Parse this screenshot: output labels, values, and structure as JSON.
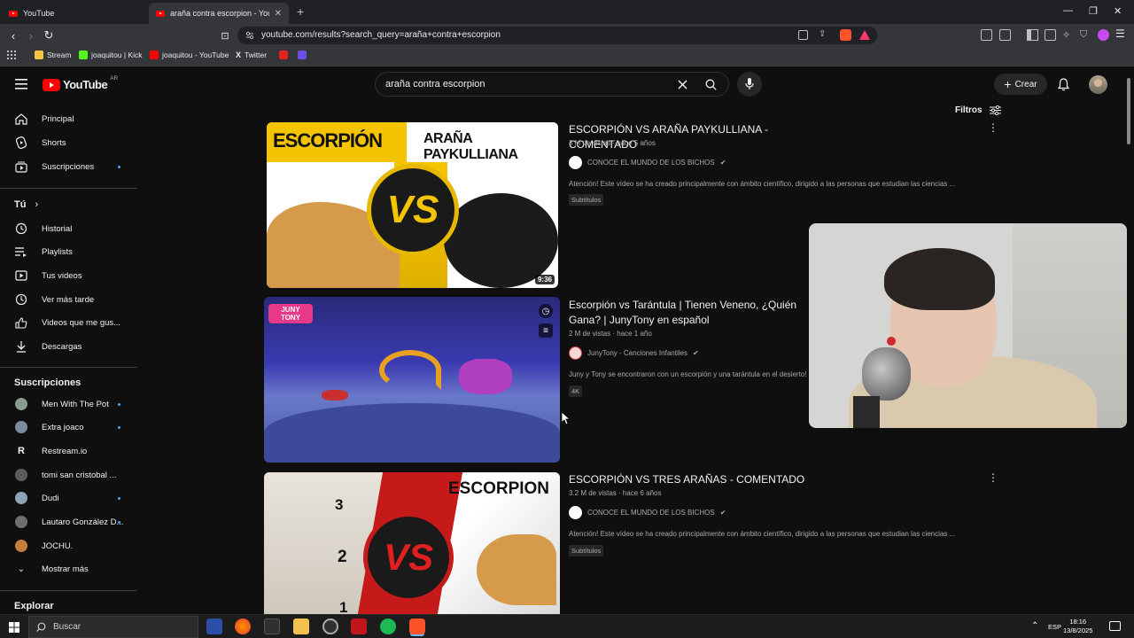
{
  "browser": {
    "tabs": [
      {
        "title": "YouTube",
        "active": false
      },
      {
        "title": "araña contra escorpion - YouTube",
        "active": true
      }
    ],
    "url": "youtube.com/results?search_query=araña+contra+escorpion",
    "bookmarks": [
      {
        "label": "Stream",
        "icon": "folder-icon",
        "color": "#f6c445"
      },
      {
        "label": "joaquitou | Kick",
        "icon": "kick-icon",
        "color": "#53fc18"
      },
      {
        "label": "joaquitou - YouTube",
        "icon": "youtube-icon",
        "color": "#ff0000"
      },
      {
        "label": "Twitter",
        "icon": "x-icon",
        "color": "#000000"
      },
      {
        "label": "",
        "icon": "red-bookmark-icon",
        "color": "#e02424"
      },
      {
        "label": "",
        "icon": "purple-bookmark-icon",
        "color": "#6c4ee4"
      }
    ]
  },
  "header": {
    "logo_text": "YouTube",
    "region": "AR",
    "search_value": "araña contra escorpion",
    "create_label": "Crear",
    "filters_label": "Filtros"
  },
  "sidebar": {
    "main": [
      {
        "label": "Principal",
        "icon": "home-icon",
        "dot": false
      },
      {
        "label": "Shorts",
        "icon": "shorts-icon",
        "dot": false
      },
      {
        "label": "Suscripciones",
        "icon": "subscriptions-icon",
        "dot": true
      }
    ],
    "you_label": "Tú",
    "you": [
      {
        "label": "Historial",
        "icon": "history-icon"
      },
      {
        "label": "Playlists",
        "icon": "playlists-icon"
      },
      {
        "label": "Tus videos",
        "icon": "your-videos-icon"
      },
      {
        "label": "Ver más tarde",
        "icon": "watch-later-icon"
      },
      {
        "label": "Videos que me gus...",
        "icon": "liked-icon"
      },
      {
        "label": "Descargas",
        "icon": "download-icon"
      }
    ],
    "subs_label": "Suscripciones",
    "subs": [
      {
        "label": "Men With The Pot",
        "color": "#8a9a8c",
        "dot": true
      },
      {
        "label": "Extra joaco",
        "color": "#7b8a9a",
        "dot": true
      },
      {
        "label": "Restream.io",
        "color": "#0f0f0f",
        "dot": false
      },
      {
        "label": "tomi san cristobal ...",
        "color": "#5c5c5c",
        "dot": false
      },
      {
        "label": "Dudi",
        "color": "#8fa3b8",
        "dot": true
      },
      {
        "label": "Lautaro González D...",
        "color": "#6d6d6d",
        "dot": true
      },
      {
        "label": "JOCHU.",
        "color": "#c87d3a",
        "dot": false
      }
    ],
    "more_label": "Mostrar más",
    "explore_label": "Explorar"
  },
  "results": [
    {
      "title": "ESCORPIÓN VS ARAÑA PAYKULLIANA - COMENTADO",
      "meta": "3 M de vistas · hace 5 años",
      "channel": "CONOCE EL MUNDO DE LOS BICHOS",
      "description": "Atención! Este vídeo se ha creado principalmente con ámbito científico, dirigido a las personas que estudian las ciencias ...",
      "badge": "Subtítulos",
      "duration": "9:36",
      "thumb_left_text": "ESCORPIÓN",
      "thumb_right_text": "ARAÑA PAYKULLIANA",
      "thumb_center_text": "VS"
    },
    {
      "title": "Escorpión vs Tarántula | Tienen Veneno, ¿Quién Gana? | JunyTony en español",
      "meta": "2 M de vistas · hace 1 año",
      "channel": "JunyTony - Canciones Infantiles",
      "description": "Juny y Tony se encontraron con un escorpión y una tarántula en el desierto! ¿Qué pasará?",
      "badge": "4K",
      "thumb_logo_text": "JUNY TONY"
    },
    {
      "title": "ESCORPIÓN VS TRES ARAÑAS - COMENTADO",
      "meta": "3.2 M de vistas · hace 6 años",
      "channel": "CONOCE EL MUNDO DE LOS BICHOS",
      "description": "Atención! Este vídeo se ha creado principalmente con ámbito científico, dirigido a las personas que estudian las ciencias ...",
      "badge": "Subtítulos",
      "thumb_right_text": "ESCORPION",
      "thumb_center_text": "VS",
      "thumb_numbers": [
        "3",
        "2",
        "1"
      ]
    }
  ],
  "taskbar": {
    "search_placeholder": "Buscar",
    "lang": "ESP",
    "time": "18:16",
    "date": "13/8/2025"
  }
}
